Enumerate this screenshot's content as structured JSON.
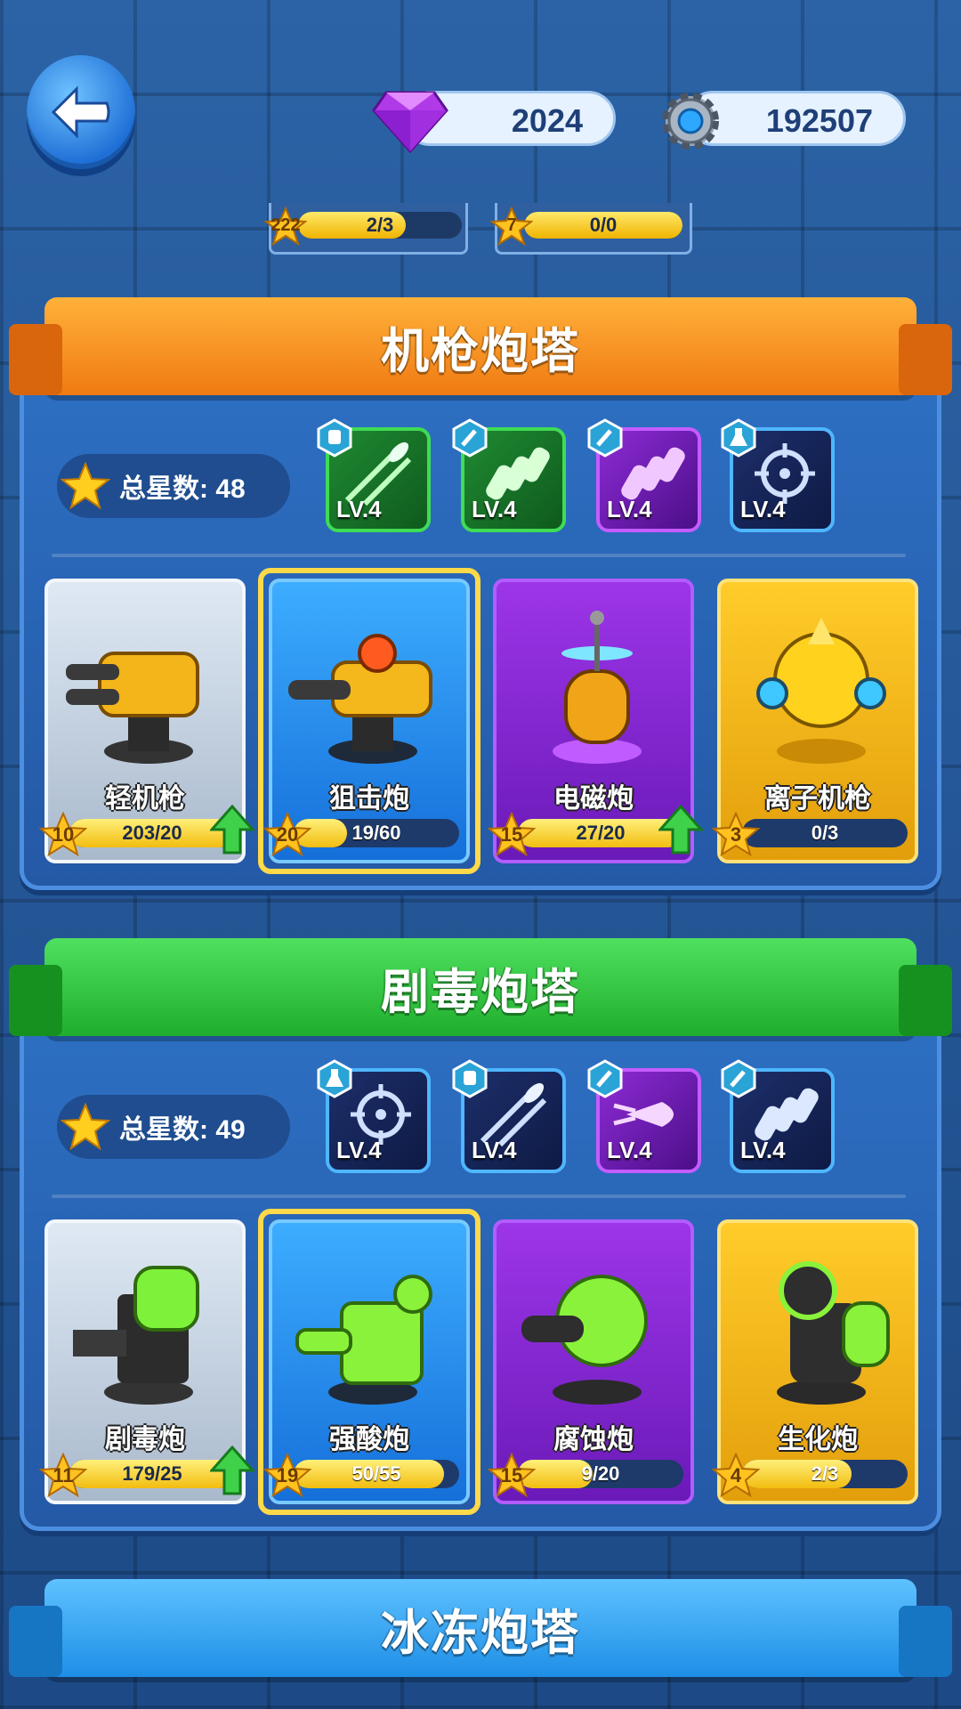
{
  "currency": {
    "gems": "2024",
    "gears": "192507"
  },
  "top_partial": [
    {
      "star_level": "222",
      "progress_text": "2/3",
      "fill": 0.66
    },
    {
      "star_level": "7",
      "progress_text": "0/0",
      "fill": 1.0
    }
  ],
  "sections": [
    {
      "title": "机枪炮塔",
      "star_total_label": "总星数: 48",
      "upgrades": [
        {
          "level": "LV.4",
          "icon": "bullet-speed-icon",
          "badge": "robot-icon",
          "color": "green"
        },
        {
          "level": "LV.4",
          "icon": "ammo-rounds-icon",
          "badge": "wrench-icon",
          "color": "green"
        },
        {
          "level": "LV.4",
          "icon": "ammo-rounds-icon",
          "badge": "wrench-icon",
          "color": "purple"
        },
        {
          "level": "LV.4",
          "icon": "crosshair-icon",
          "badge": "flask-icon",
          "color": "navy"
        }
      ],
      "towers": [
        {
          "name": "轻机枪",
          "star_level": "10",
          "progress_text": "203/20",
          "fill": 1.0,
          "upgradable": true,
          "rarity": "white"
        },
        {
          "name": "狙击炮",
          "star_level": "20",
          "progress_text": "19/60",
          "fill": 0.32,
          "upgradable": false,
          "rarity": "blue",
          "selected": true
        },
        {
          "name": "电磁炮",
          "star_level": "15",
          "progress_text": "27/20",
          "fill": 1.0,
          "upgradable": true,
          "rarity": "purple"
        },
        {
          "name": "离子机枪",
          "star_level": "3",
          "progress_text": "0/3",
          "fill": 0.0,
          "upgradable": false,
          "rarity": "gold"
        }
      ]
    },
    {
      "title": "剧毒炮塔",
      "star_total_label": "总星数: 49",
      "upgrades": [
        {
          "level": "LV.4",
          "icon": "crosshair-icon",
          "badge": "flask-icon",
          "color": "navy"
        },
        {
          "level": "LV.4",
          "icon": "bullet-speed-icon",
          "badge": "robot-icon",
          "color": "navy"
        },
        {
          "level": "LV.4",
          "icon": "piercing-bullet-icon",
          "badge": "wrench-icon",
          "color": "purple"
        },
        {
          "level": "LV.4",
          "icon": "ammo-rounds-icon",
          "badge": "wrench-icon",
          "color": "navy"
        }
      ],
      "towers": [
        {
          "name": "剧毒炮",
          "star_level": "11",
          "progress_text": "179/25",
          "fill": 1.0,
          "upgradable": true,
          "rarity": "white"
        },
        {
          "name": "强酸炮",
          "star_level": "19",
          "progress_text": "50/55",
          "fill": 0.91,
          "upgradable": false,
          "rarity": "blue",
          "selected": true
        },
        {
          "name": "腐蚀炮",
          "star_level": "15",
          "progress_text": "9/20",
          "fill": 0.45,
          "upgradable": false,
          "rarity": "purple"
        },
        {
          "name": "生化炮",
          "star_level": "4",
          "progress_text": "2/3",
          "fill": 0.66,
          "upgradable": false,
          "rarity": "gold"
        }
      ]
    },
    {
      "title": "冰冻炮塔"
    }
  ],
  "colors": {
    "orange_ribbon": "#f07a12",
    "green_ribbon": "#1fae2c",
    "blue_ribbon": "#1e8ee6",
    "selection": "#ffd94a",
    "progress_fill": "#f2bd10"
  }
}
